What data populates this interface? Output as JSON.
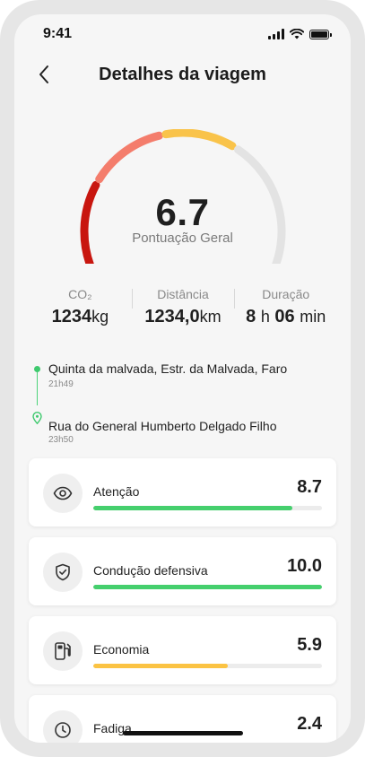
{
  "status_bar": {
    "time": "9:41"
  },
  "header": {
    "title": "Detalhes da viagem",
    "back_icon": "chevron-left-icon"
  },
  "score": {
    "value": "6.7",
    "label": "Pontuação Geral",
    "gauge_fraction": 0.67,
    "segment_colors": [
      "#c8160f",
      "#f47d6c",
      "#f9c34a",
      "#e3e3e3"
    ]
  },
  "stats": [
    {
      "label": "CO₂",
      "value": "1234",
      "unit": "kg"
    },
    {
      "label": "Distância",
      "value": "1234,0",
      "unit": "km"
    },
    {
      "label": "Duração",
      "hours": "8",
      "h_unit": "h",
      "minutes": "06",
      "min_unit": "min"
    }
  ],
  "route": {
    "origin": {
      "address": "Quinta da malvada, Estr. da Malvada, Faro",
      "time": "21h49"
    },
    "destination": {
      "address": "Rua do General Humberto Delgado Filho",
      "time": "23h50"
    }
  },
  "metrics": [
    {
      "label": "Atenção",
      "value": "8.7",
      "fraction": 0.87,
      "color": "#45cf6d",
      "icon": "eye-icon"
    },
    {
      "label": "Condução defensiva",
      "value": "10.0",
      "fraction": 1.0,
      "color": "#45cf6d",
      "icon": "shield-check-icon"
    },
    {
      "label": "Economia",
      "value": "5.9",
      "fraction": 0.59,
      "color": "#fbc343",
      "icon": "fuel-pump-icon"
    },
    {
      "label": "Fadiga",
      "value": "2.4",
      "fraction": 0.24,
      "color": "#f47d6c",
      "icon": "clock-icon"
    }
  ]
}
